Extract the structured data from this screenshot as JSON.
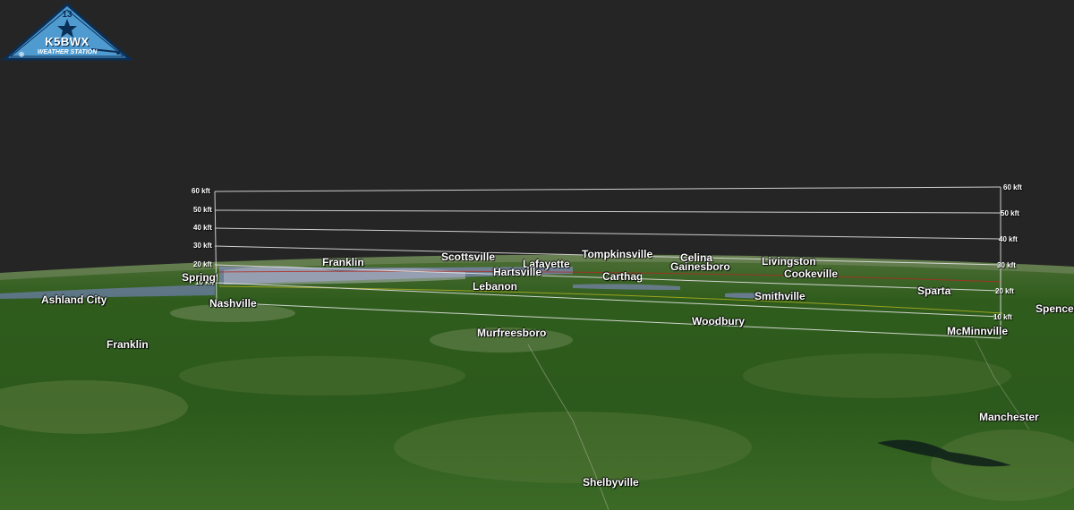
{
  "logo": {
    "callsign": "K5BWX",
    "subtitle": "WEATHER STATION"
  },
  "altitude_scale": {
    "left": [
      "60 kft",
      "50 kft",
      "40 kft",
      "30 kft",
      "20 kft",
      "10 kft"
    ],
    "right": [
      "60 kft",
      "50 kft",
      "40 kft",
      "30 kft",
      "20 kft",
      "10 kft"
    ]
  },
  "cities": [
    "Ashland City",
    "Springfield",
    "Nashville",
    "Franklin",
    "Franklin",
    "Scottsville",
    "Lafayette",
    "Hartsville",
    "Lebanon",
    "Murfreesboro",
    "Tompkinsville",
    "Carthage",
    "Celina",
    "Gainesboro",
    "Livingston",
    "Cookeville",
    "Smithville",
    "Woodbury",
    "Sparta",
    "McMinnville",
    "Spencer",
    "Manchester",
    "Shelbyville"
  ],
  "colors": {
    "sky": "#252525",
    "terrain": "#2f5a1c",
    "grid_lines": "#d8d8d8",
    "logo_fill": "#5aa6d8"
  }
}
